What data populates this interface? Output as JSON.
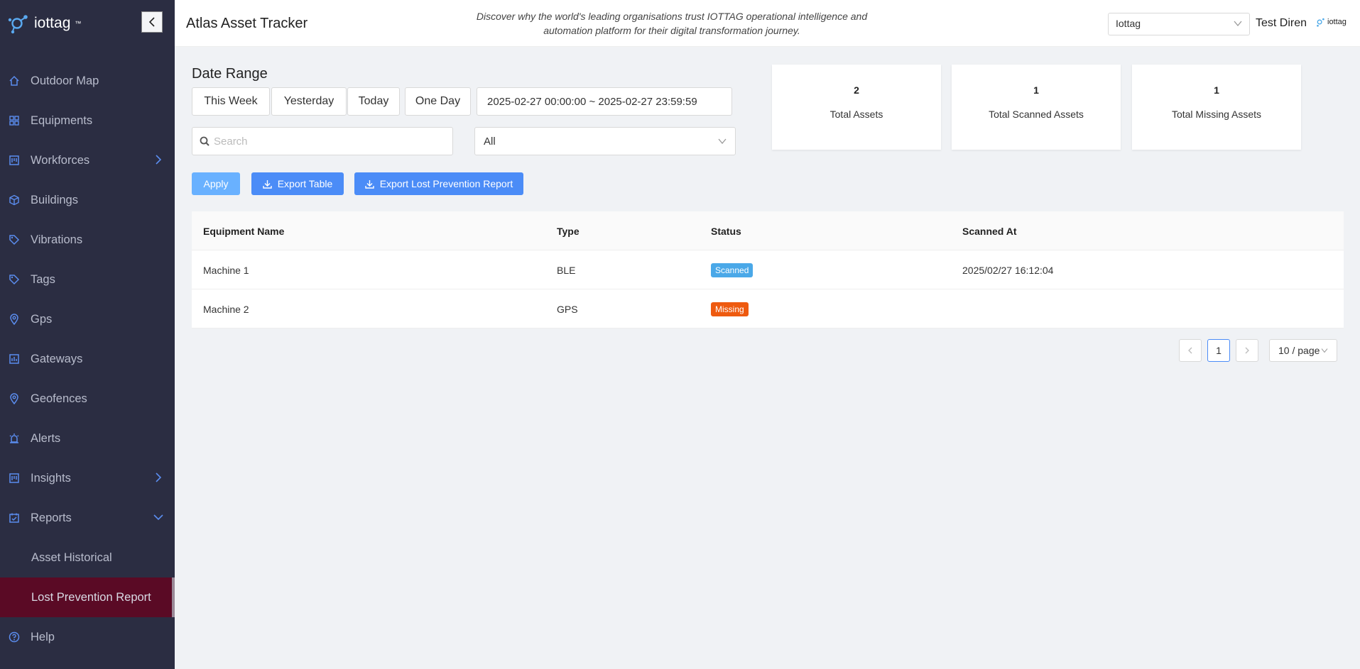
{
  "brand": {
    "logo_text": "iottag",
    "trademark": "™"
  },
  "sidebar": {
    "items": [
      {
        "label": "Outdoor Map",
        "icon": "home-icon"
      },
      {
        "label": "Equipments",
        "icon": "grid-icon"
      },
      {
        "label": "Workforces",
        "icon": "board-icon",
        "expandable": true
      },
      {
        "label": "Buildings",
        "icon": "cube-icon"
      },
      {
        "label": "Vibrations",
        "icon": "tag-icon"
      },
      {
        "label": "Tags",
        "icon": "tag-icon"
      },
      {
        "label": "Gps",
        "icon": "location-pin-icon"
      },
      {
        "label": "Gateways",
        "icon": "chart-icon"
      },
      {
        "label": "Geofences",
        "icon": "location-pin-icon"
      },
      {
        "label": "Alerts",
        "icon": "alarm-icon"
      },
      {
        "label": "Insights",
        "icon": "board-icon",
        "expandable": true
      },
      {
        "label": "Reports",
        "icon": "calendar-check-icon",
        "expanded": true
      },
      {
        "label": "Asset Historical",
        "sub": true
      },
      {
        "label": "Lost Prevention Report",
        "sub": true,
        "active": true
      },
      {
        "label": "Help",
        "icon": "question-circle-icon"
      }
    ]
  },
  "header": {
    "title": "Atlas Asset Tracker",
    "tagline": "Discover why the world's leading organisations trust IOTTAG operational intelligence and automation platform for their digital transformation journey.",
    "org_select": "Iottag",
    "user_name": "Test Diren",
    "mini_logo_text": "iottag"
  },
  "filters": {
    "section_title": "Date Range",
    "quick_ranges": [
      "This Week",
      "Yesterday",
      "Today",
      "One Day"
    ],
    "date_range": "2025-02-27 00:00:00 ~ 2025-02-27 23:59:59",
    "search_placeholder": "Search",
    "status_filter": "All"
  },
  "actions": {
    "apply": "Apply",
    "export_table": "Export Table",
    "export_report": "Export Lost Prevention Report"
  },
  "stats": [
    {
      "value": "2",
      "label": "Total Assets"
    },
    {
      "value": "1",
      "label": "Total Scanned Assets"
    },
    {
      "value": "1",
      "label": "Total Missing Assets"
    }
  ],
  "table": {
    "columns": [
      "Equipment Name",
      "Type",
      "Status",
      "Scanned At"
    ],
    "rows": [
      {
        "name": "Machine 1",
        "type": "BLE",
        "status": "Scanned",
        "scanned_at": "2025/02/27 16:12:04"
      },
      {
        "name": "Machine 2",
        "type": "GPS",
        "status": "Missing",
        "scanned_at": ""
      }
    ]
  },
  "pagination": {
    "current_page": "1",
    "page_size": "10 / page"
  },
  "colors": {
    "sidebar_bg": "#2b2d42",
    "active_item": "#5a0a25",
    "primary": "#4b8cf7",
    "scanned": "#4aa8e8",
    "missing": "#ee5a0f",
    "nav_icon": "#5b8def"
  }
}
